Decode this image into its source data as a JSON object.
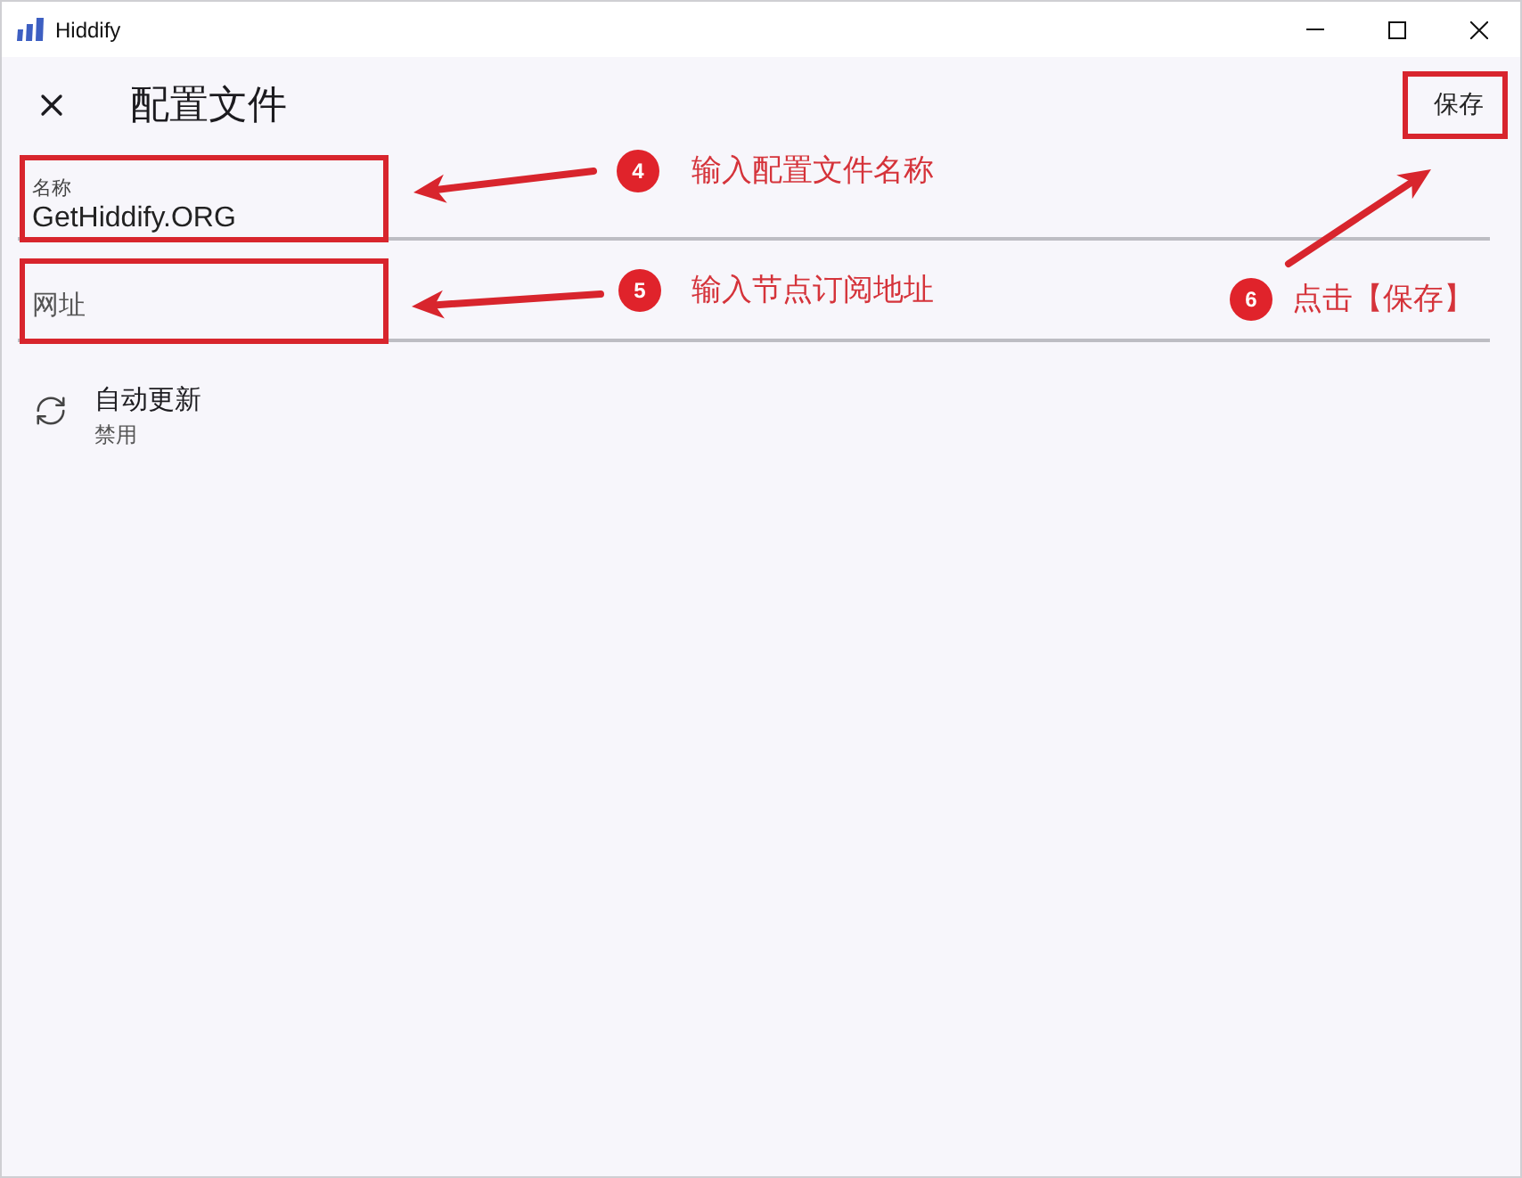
{
  "window": {
    "title": "Hiddify"
  },
  "app_bar": {
    "title": "配置文件",
    "save_button": {
      "label": "保存",
      "highlighted": true
    }
  },
  "fields": [
    {
      "kind": "filled",
      "label": "名称",
      "value": "GetHiddify.ORG",
      "highlighted": true
    },
    {
      "kind": "empty",
      "placeholder": "网址",
      "highlighted": true
    }
  ],
  "settings": [
    {
      "title": "自动更新",
      "value": "禁用"
    }
  ],
  "annotations": [
    {
      "number": "4",
      "text": "输入配置文件名称"
    },
    {
      "number": "5",
      "text": "输入节点订阅地址"
    },
    {
      "number": "6",
      "text": "点击【保存】"
    }
  ]
}
